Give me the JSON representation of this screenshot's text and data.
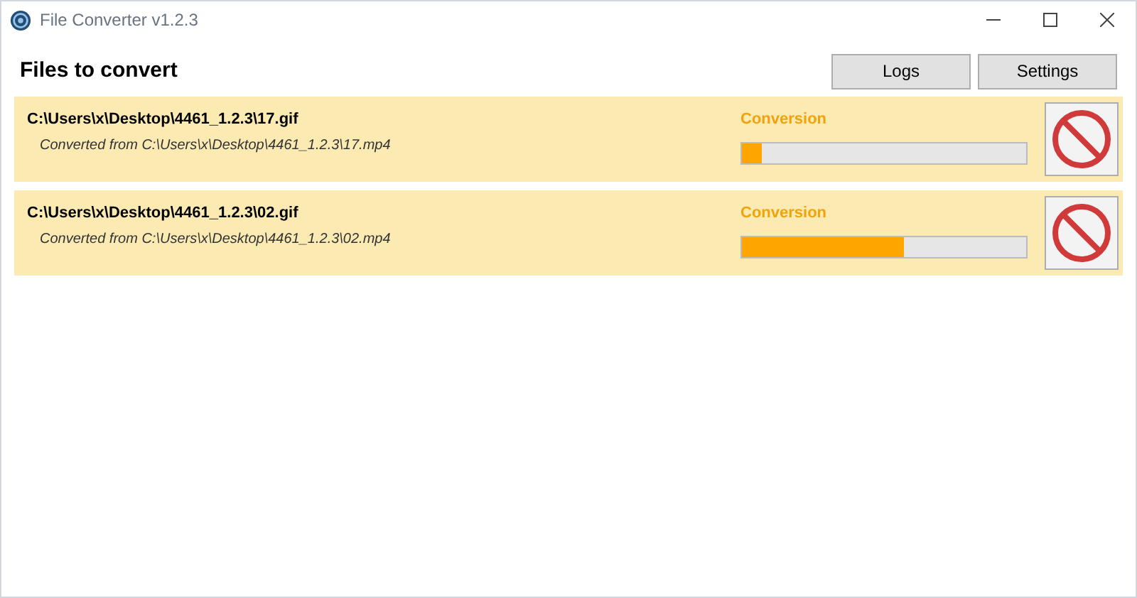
{
  "window": {
    "title": "File Converter v1.2.3"
  },
  "header": {
    "title": "Files to convert",
    "buttons": [
      "Logs",
      "Settings"
    ]
  },
  "jobs": [
    {
      "output": "C:\\Users\\x\\Desktop\\4461_1.2.3\\17.gif",
      "source": "Converted from  C:\\Users\\x\\Desktop\\4461_1.2.3\\17.mp4",
      "stage": "Conversion",
      "level": 0.07
    },
    {
      "output": "C:\\Users\\x\\Desktop\\4461_1.2.3\\02.gif",
      "source": "Converted from  C:\\Users\\x\\Desktop\\4461_1.2.3\\02.mp4",
      "stage": "Conversion",
      "level": 0.57
    }
  ]
}
